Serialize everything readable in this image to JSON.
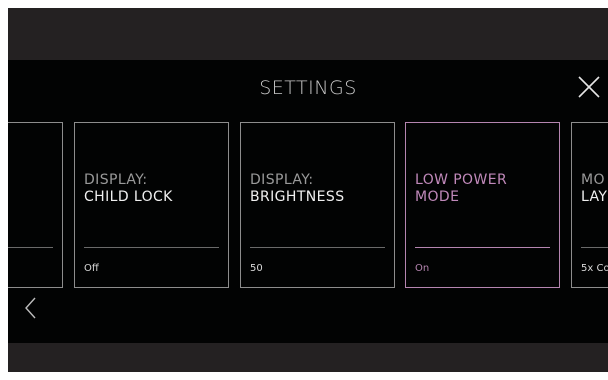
{
  "header": {
    "title": "SETTINGS"
  },
  "icons": {
    "close": "close-icon",
    "prev": "chevron-left-icon"
  },
  "colors": {
    "accent": "#b585b0",
    "panel": "#020303",
    "frame": "#242122"
  },
  "cards": [
    {
      "category": "",
      "name": "",
      "value": ""
    },
    {
      "category": "DISPLAY:",
      "name": "CHILD LOCK",
      "value": "Off"
    },
    {
      "category": "DISPLAY:",
      "name": "BRIGHTNESS",
      "value": "50"
    },
    {
      "category": "LOW POWER",
      "name": "MODE",
      "value": "On",
      "selected": true
    },
    {
      "category": "MO",
      "name": "LAY",
      "value": "5x Co"
    }
  ]
}
